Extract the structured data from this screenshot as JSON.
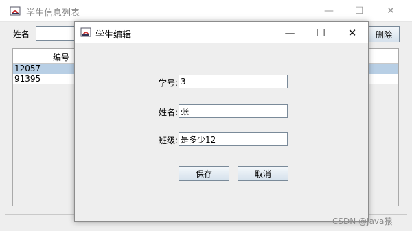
{
  "main_window": {
    "title": "学生信息列表",
    "name_label": "姓名",
    "name_input_value": "",
    "delete_button": "删除",
    "table": {
      "headers": [
        "编号"
      ],
      "rows": [
        [
          "12057"
        ],
        [
          "91395"
        ]
      ]
    }
  },
  "dialog": {
    "title": "学生编辑",
    "fields": {
      "student_id": {
        "label": "学号:",
        "value": "3"
      },
      "name": {
        "label": "姓名:",
        "value": "张"
      },
      "class": {
        "label": "班级:",
        "value": "是多少12"
      }
    },
    "save_button": "保存",
    "cancel_button": "取消"
  },
  "window_controls": {
    "minimize": "—",
    "maximize": "☐",
    "close": "✕"
  },
  "watermark": "CSDN @Java猿_",
  "colors": {
    "selection": "#b8cfe5",
    "button_top": "#f4f8fb",
    "button_bottom": "#d5e1ec",
    "border": "#7a8a99"
  },
  "icons": [
    "java-app-icon",
    "minimize-icon",
    "maximize-icon",
    "close-icon"
  ]
}
